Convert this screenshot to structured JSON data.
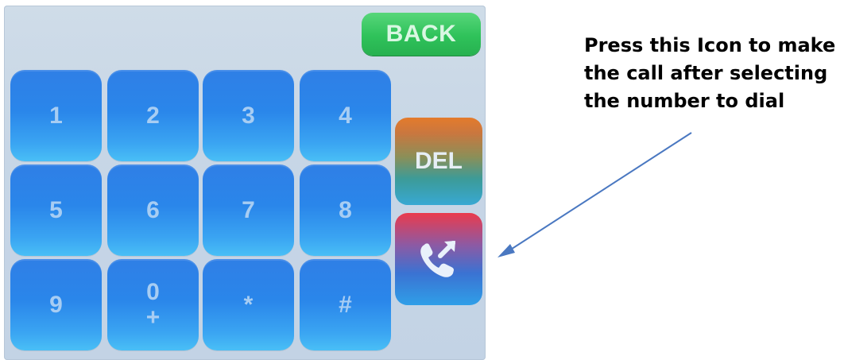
{
  "screen": {
    "back_label": "BACK",
    "keys": [
      "1",
      "2",
      "3",
      "4",
      "5",
      "6",
      "7",
      "8",
      "9",
      "0",
      "+",
      "*",
      "#"
    ],
    "del_label": "DEL",
    "call_icon": "phone-outgoing-icon"
  },
  "annotation": {
    "caption": "Press this Icon to make the call after selecting the number to dial"
  },
  "colors": {
    "key_blue": "#2f86ea",
    "back_green": "#2fc25a",
    "arrow": "#4a78c1"
  }
}
